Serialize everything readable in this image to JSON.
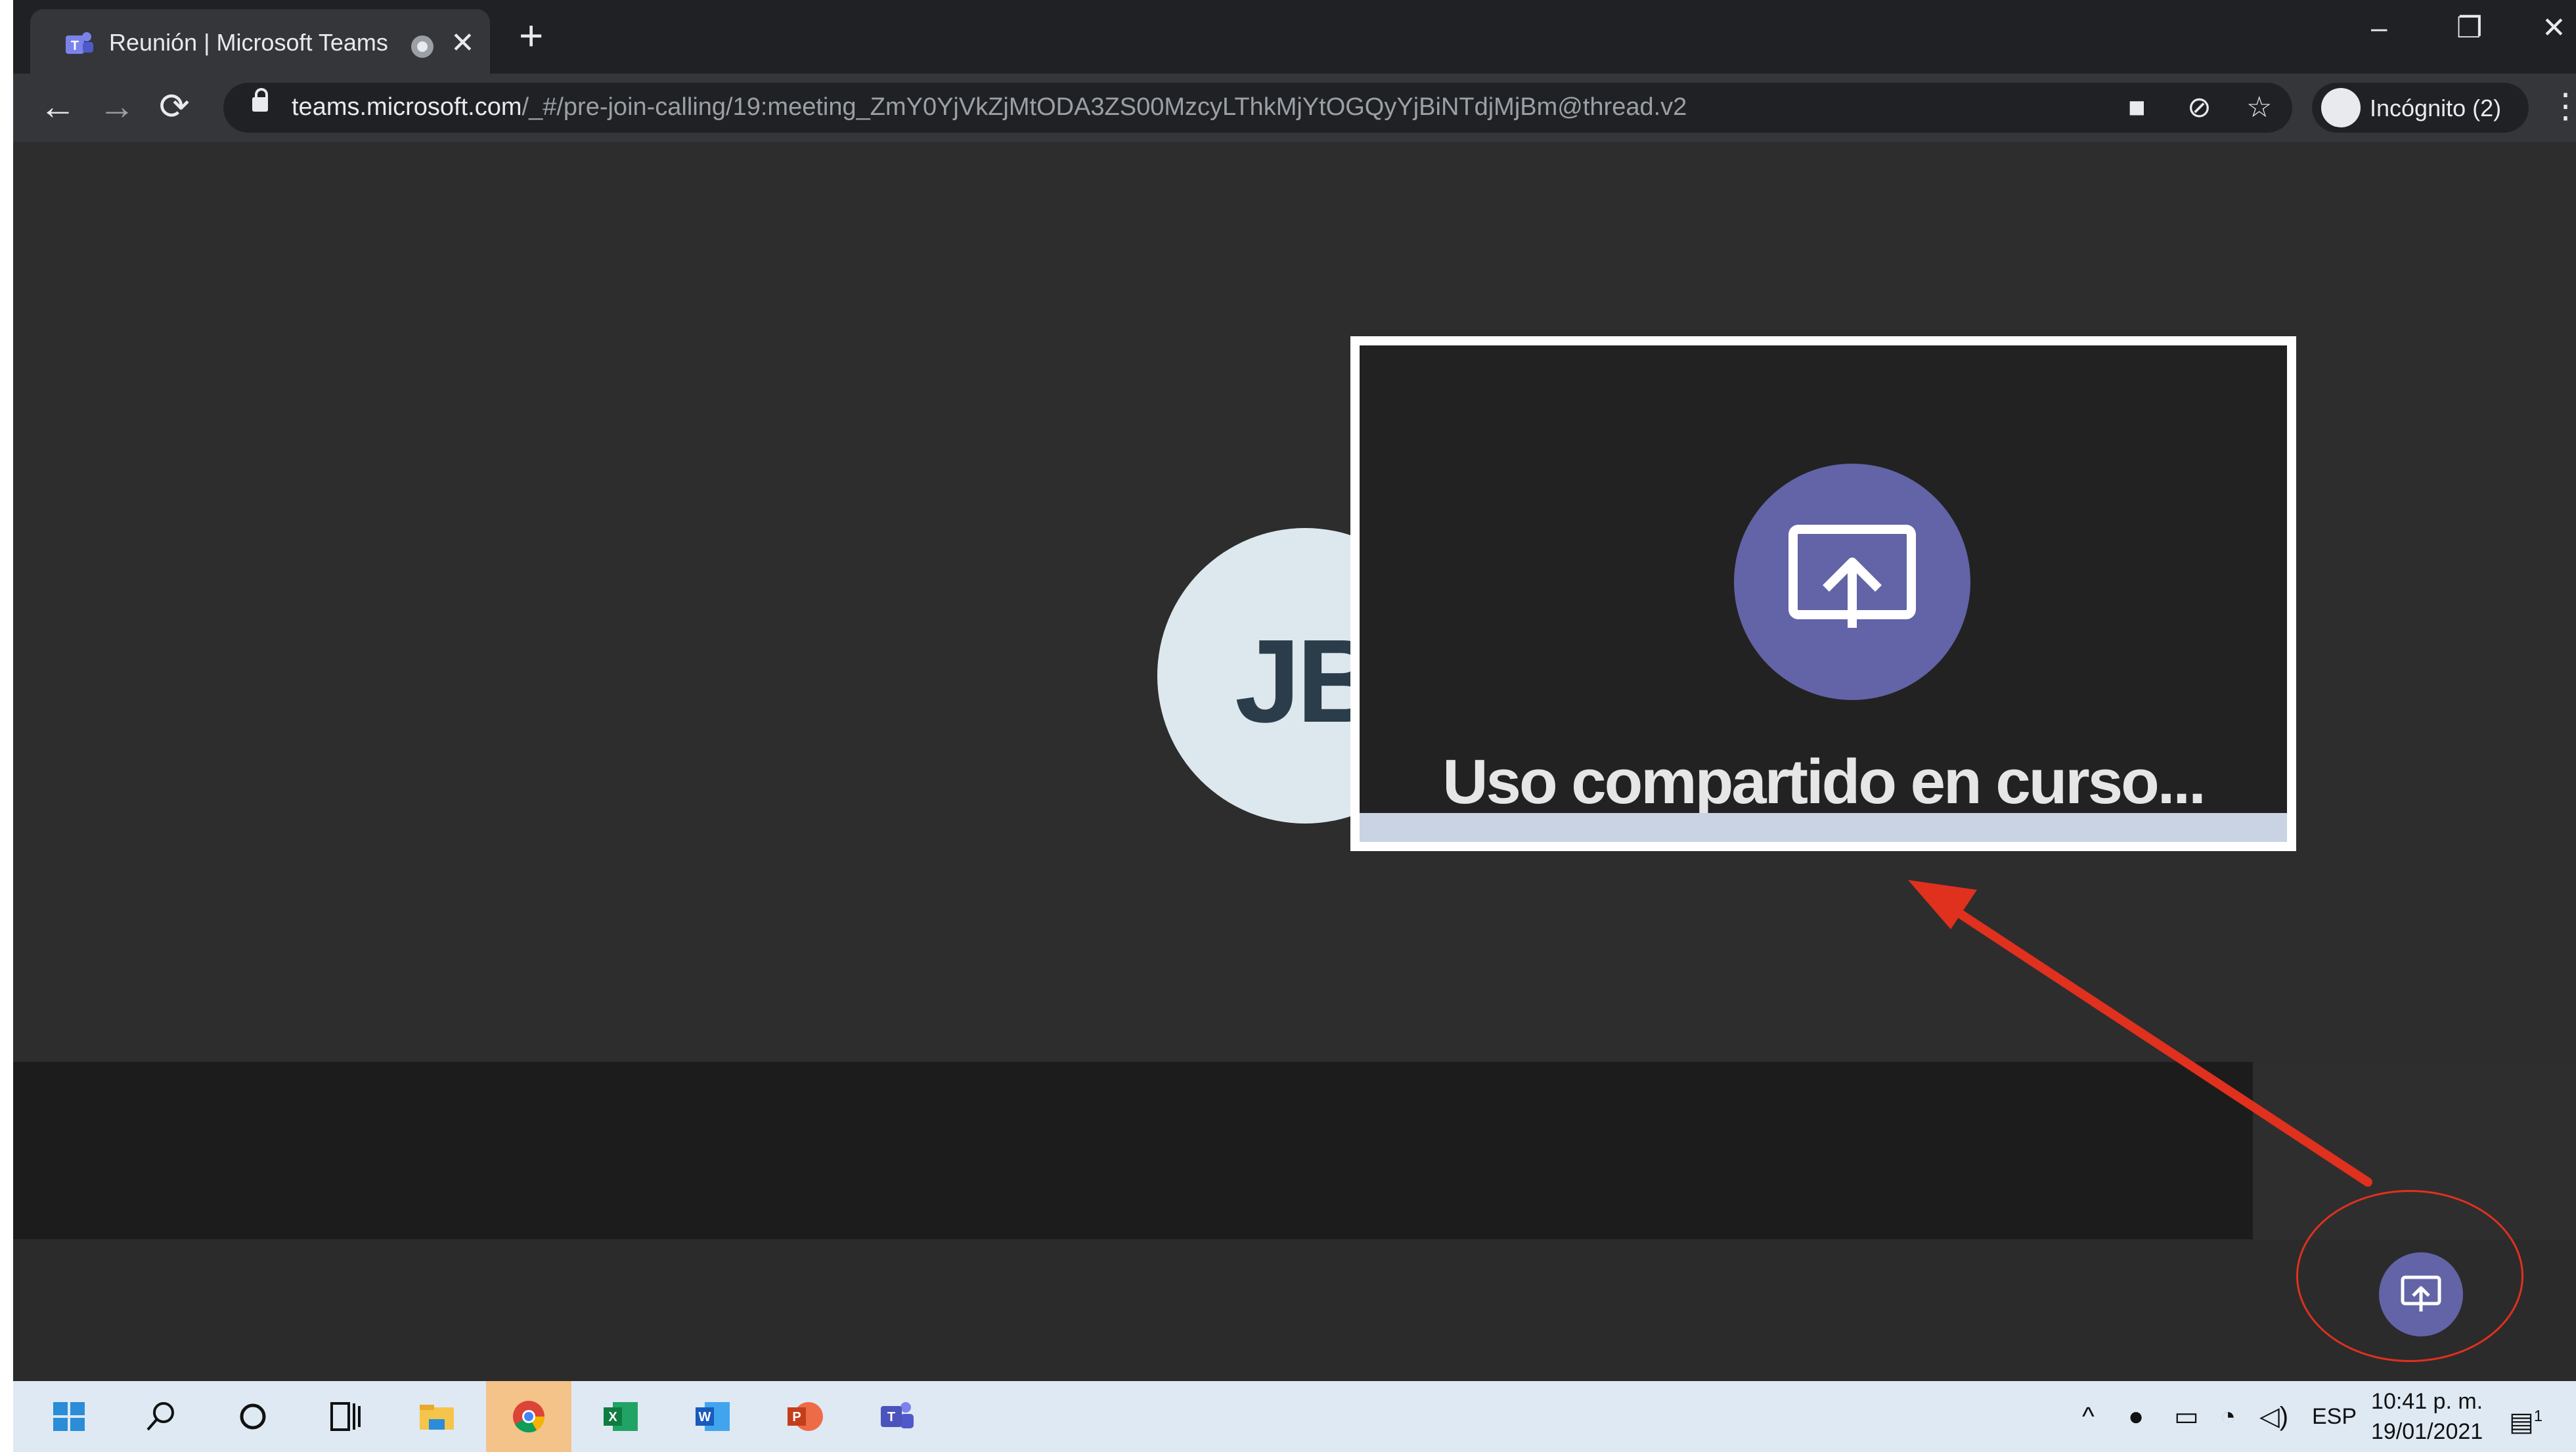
{
  "browser": {
    "tab_title": "Reunión | Microsoft Teams",
    "tab_close": "✕",
    "new_tab": "+",
    "url_domain": "teams.microsoft.com",
    "url_path": "/_#/pre-join-calling/19:meeting_ZmY0YjVkZjMtODA3ZS00MzcyLThkMjYtOGQyYjBiNTdjMjBm@thread.v2",
    "profile_label": "Incógnito (2)",
    "back": "←",
    "forward": "→",
    "reload": "⟳",
    "minimize": "–",
    "restore": "❐",
    "close": "✕",
    "menu": "⋮"
  },
  "meeting": {
    "avatar_initials": "JB",
    "zoom_caption": "Uso compartido en curso..."
  },
  "taskbar": {
    "tray_lang": "ESP",
    "time": "10:41 p. m.",
    "date": "19/01/2021",
    "notification_count": "1"
  },
  "colors": {
    "teams_purple": "#6264a7",
    "annotation_red": "#e0301e"
  },
  "icons": [
    "teams-icon",
    "record-icon",
    "lock-icon",
    "camera-icon",
    "eye-off-icon",
    "star-icon",
    "incognito-icon",
    "share-screen-icon",
    "windows-icon",
    "search-icon",
    "cortana-icon",
    "task-view-icon",
    "file-explorer-icon",
    "chrome-icon",
    "excel-icon",
    "word-icon",
    "powerpoint-icon",
    "teams-taskbar-icon"
  ]
}
